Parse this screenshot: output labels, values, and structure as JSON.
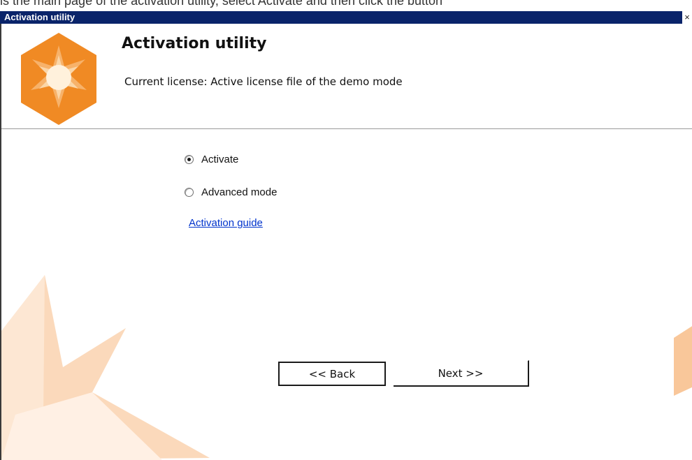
{
  "top_strip_text": "is the main page of the activation utility, select Activate and then click the button",
  "window": {
    "title": "Activation utility",
    "close_glyph": "×"
  },
  "header": {
    "title": "Activation utility",
    "license_text": "Current license: Active license file of the demo mode",
    "logo_icon": "orange-star-hexagon-logo"
  },
  "options": {
    "activate_label": "Activate",
    "advanced_label": "Advanced mode",
    "selected": "Activate"
  },
  "guide_link": "Activation guide",
  "buttons": {
    "back": "<< Back",
    "next": "Next >>"
  },
  "colors": {
    "titlebar": "#0a246a",
    "accent_orange": "#f08a24",
    "link": "#0033cc"
  }
}
